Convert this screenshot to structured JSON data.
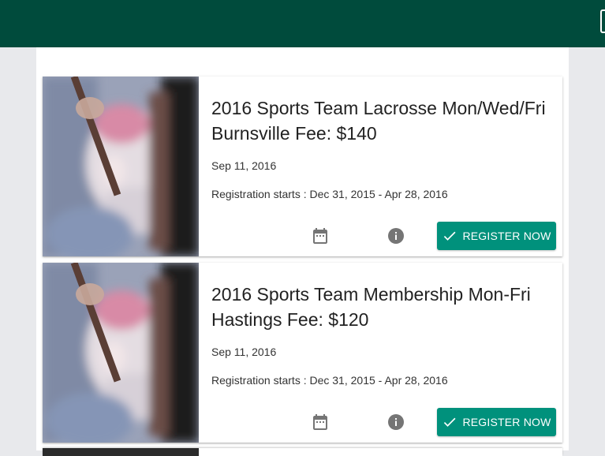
{
  "colors": {
    "header": "#004b3c",
    "accent": "#00917c",
    "page_bg": "#e8e9ec"
  },
  "events": [
    {
      "title": "2016 Sports Team Lacrosse Mon/Wed/Fri Burnsville Fee: $140",
      "date": "Sep 11, 2016",
      "registration": "Registration starts : Dec 31, 2015 - Apr 28, 2016",
      "register_label": "REGISTER NOW",
      "icons": [
        "calendar-icon",
        "info-icon",
        "check-icon"
      ]
    },
    {
      "title": "2016 Sports Team Membership Mon-Fri Hastings Fee: $120",
      "date": "Sep 11, 2016",
      "registration": "Registration starts : Dec 31, 2015 - Apr 28, 2016",
      "register_label": "REGISTER NOW",
      "icons": [
        "calendar-icon",
        "info-icon",
        "check-icon"
      ]
    }
  ]
}
